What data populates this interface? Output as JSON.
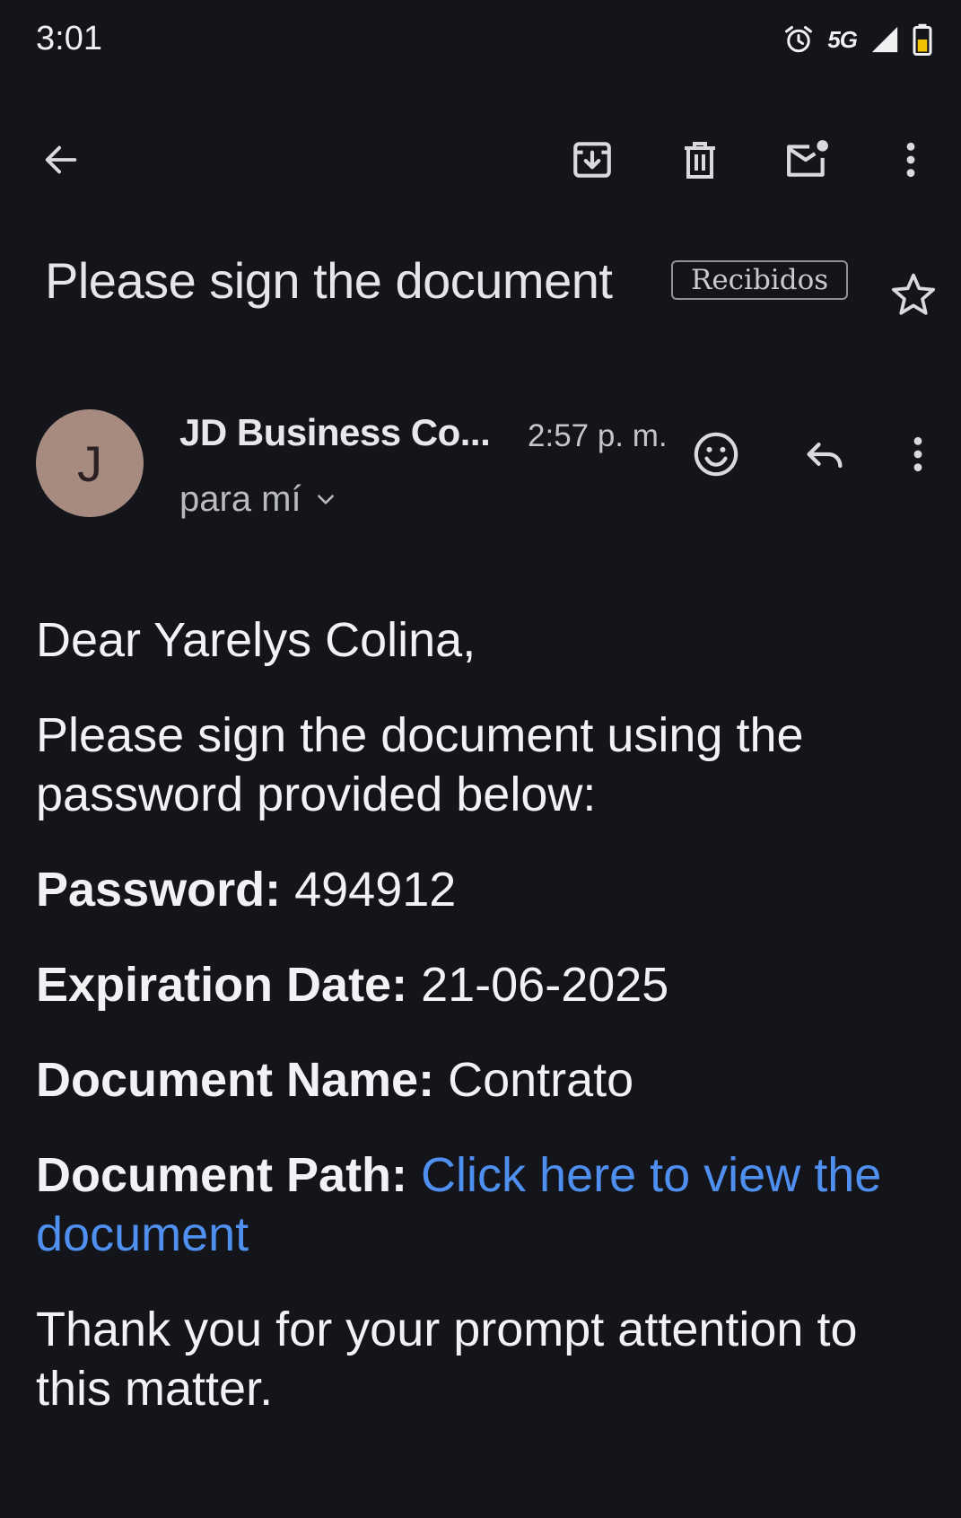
{
  "status_bar": {
    "time": "3:01",
    "network": "5G",
    "icons": [
      "alarm-icon",
      "signal-icon",
      "battery-icon"
    ]
  },
  "toolbar": {
    "back_icon": "arrow-back-icon",
    "actions": [
      "archive-icon",
      "delete-icon",
      "mark-unread-icon",
      "more-vert-icon"
    ]
  },
  "email": {
    "subject": "Please sign the document",
    "label": "Recibidos",
    "sender": {
      "initial": "J",
      "name": "JD Business Co...",
      "time": "2:57 p. m.",
      "recipient": "para mí",
      "avatar_color": "#a78a80"
    },
    "body": {
      "greeting": "Dear Yarelys Colina,",
      "intro": "Please sign the document using the password provided below:",
      "password_label": "Password:",
      "password_value": "494912",
      "expiration_label": "Expiration Date:",
      "expiration_value": "21-06-2025",
      "doc_name_label": "Document Name:",
      "doc_name_value": "Contrato",
      "doc_path_label": "Document Path:",
      "doc_path_link": "Click here to view the document",
      "closing": "Thank you for your prompt attention to this matter."
    }
  },
  "colors": {
    "background": "#13151b",
    "link": "#4f8ff0",
    "text": "#f2f2f4"
  }
}
